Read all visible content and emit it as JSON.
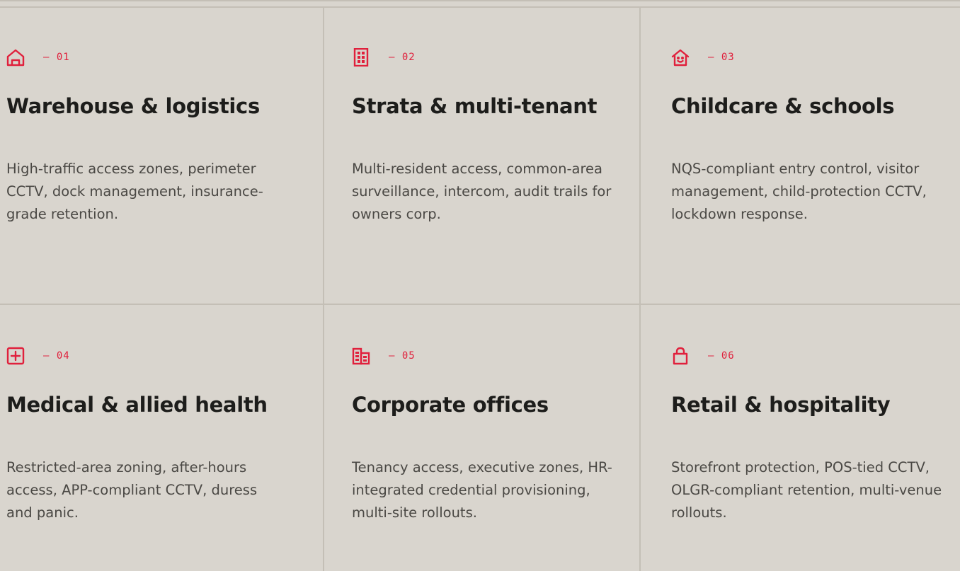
{
  "colors": {
    "background": "#d9d5ce",
    "divider": "#c4bfb6",
    "accent": "#e0203c",
    "title": "#1d1d1b",
    "body_text": "#4a4844"
  },
  "cards": [
    {
      "icon": "warehouse-icon",
      "number": "— 01",
      "title": "Warehouse & logistics",
      "description": "High-traffic access zones, perimeter CCTV, dock management, insurance-grade retention."
    },
    {
      "icon": "building-icon",
      "number": "— 02",
      "title": "Strata & multi-tenant",
      "description": "Multi-resident access, common-area surveillance, intercom, audit trails for owners corp."
    },
    {
      "icon": "childcare-icon",
      "number": "— 03",
      "title": "Childcare & schools",
      "description": "NQS-compliant entry control, visitor management, child-protection CCTV, lockdown response."
    },
    {
      "icon": "medical-plus-icon",
      "number": "— 04",
      "title": "Medical & allied health",
      "description": "Restricted-area zoning, after-hours access, APP-compliant CCTV, duress and panic."
    },
    {
      "icon": "office-buildings-icon",
      "number": "— 05",
      "title": "Corporate offices",
      "description": "Tenancy access, executive zones, HR-integrated credential provisioning, multi-site rollouts."
    },
    {
      "icon": "shopping-bag-icon",
      "number": "— 06",
      "title": "Retail & hospitality",
      "description": "Storefront protection, POS-tied CCTV, OLGR-compliant retention, multi-venue rollouts."
    }
  ]
}
